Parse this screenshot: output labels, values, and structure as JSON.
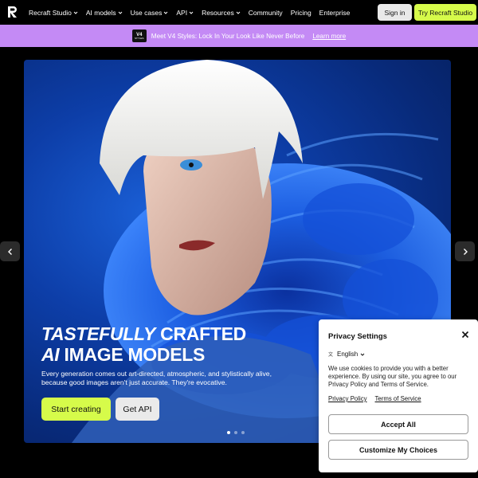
{
  "nav": {
    "logo_icon": "recraft-logo-icon",
    "items": [
      {
        "label": "Recraft Studio",
        "dropdown": true
      },
      {
        "label": "AI models",
        "dropdown": true
      },
      {
        "label": "Use cases",
        "dropdown": true
      },
      {
        "label": "API",
        "dropdown": true
      },
      {
        "label": "Resources",
        "dropdown": true
      },
      {
        "label": "Community",
        "dropdown": false
      },
      {
        "label": "Pricing",
        "dropdown": false
      },
      {
        "label": "Enterprise",
        "dropdown": false
      }
    ],
    "signin_label": "Sign in",
    "try_label": "Try Recraft Studio"
  },
  "banner": {
    "badge_main": "V4",
    "badge_sub": "STYLES",
    "text": "Meet V4 Styles: Lock In Your Look Like Never Before",
    "link": "Learn more",
    "bg_color": "#c48af5"
  },
  "hero": {
    "title_line1_a": "TASTEFULLY",
    "title_line1_b": "CRAFTED",
    "title_line2_a": "AI",
    "title_line2_b": "IMAGE MODELS",
    "description": "Every generation comes out art-directed, atmospheric, and stylistically alive, because good images aren't just accurate. They're evocative.",
    "start_label": "Start creating",
    "api_label": "Get API",
    "slides_count": 3,
    "active_slide": 1,
    "accent_color": "#d6fb4a"
  },
  "carousel": {
    "prev_icon": "chevron-left-icon",
    "next_icon": "chevron-right-icon"
  },
  "privacy": {
    "title": "Privacy Settings",
    "language": "English",
    "text": "We use cookies to provide you with a better experience. By using our site, you agree to our Privacy Policy and Terms of Service.",
    "policy_link": "Privacy Policy",
    "terms_link": "Terms of Service",
    "accept_label": "Accept All",
    "customize_label": "Customize My Choices"
  }
}
